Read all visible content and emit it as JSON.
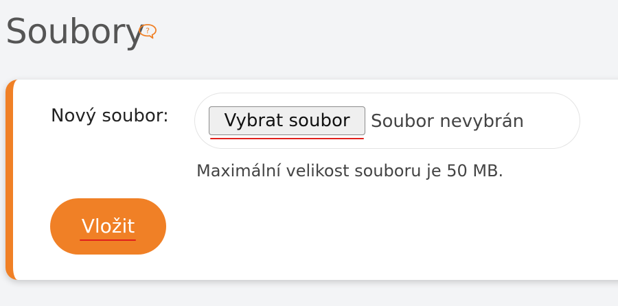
{
  "page": {
    "title": "Soubory",
    "help_icon": "help-speech-bubble-icon"
  },
  "form": {
    "label": "Nový soubor:",
    "file_button_label": "Vybrat soubor",
    "file_status": "Soubor nevybrán",
    "hint": "Maximální velikost souboru je 50 MB.",
    "submit_label": "Vložit"
  },
  "colors": {
    "accent": "#f08026",
    "background": "#f3f4f6",
    "annotation_underline": "#e0201c"
  }
}
